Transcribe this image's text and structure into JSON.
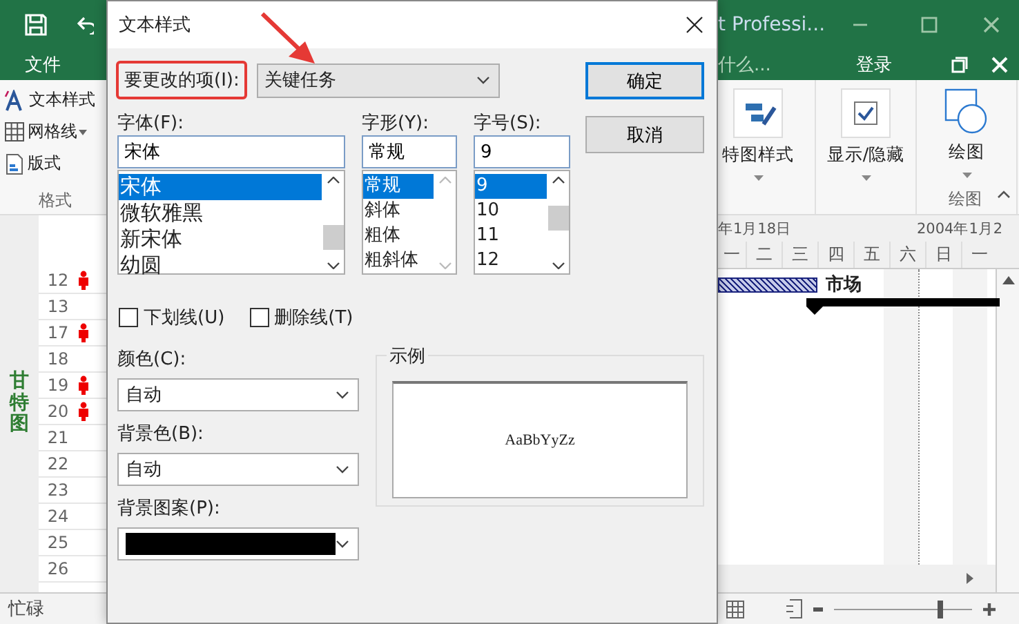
{
  "app": {
    "title": "t Professi...",
    "menu_tab": "文件",
    "tell_me": "什么...",
    "sign_in": "登录",
    "ribbon_left": [
      {
        "kind": "icon_a",
        "label": "文本样式",
        "dropdown": false
      },
      {
        "kind": "icon_grid",
        "label": "网格线",
        "dropdown": true
      },
      {
        "kind": "icon_layout",
        "label": "版式",
        "dropdown": false
      }
    ],
    "ribbon_left_group": "格式",
    "ribbon_right": [
      {
        "kind": "icon_bar_style",
        "label": "特图样式"
      },
      {
        "kind": "icon_check",
        "label": "显示/隐藏"
      },
      {
        "kind": "icon_shape",
        "label": "绘图"
      }
    ],
    "ribbon_right_group": "绘图",
    "view_label": "甘特图",
    "rows": [
      {
        "number": "12",
        "person": true
      },
      {
        "number": "13",
        "person": false
      },
      {
        "number": "17",
        "person": true
      },
      {
        "number": "18",
        "person": false
      },
      {
        "number": "19",
        "person": true
      },
      {
        "number": "20",
        "person": true
      },
      {
        "number": "21",
        "person": false
      },
      {
        "number": "22",
        "person": false
      },
      {
        "number": "23",
        "person": false
      },
      {
        "number": "24",
        "person": false
      },
      {
        "number": "25",
        "person": false
      },
      {
        "number": "26",
        "person": false
      }
    ],
    "timeline": {
      "weeks": [
        "年1月18日",
        "2004年1月2"
      ],
      "days": [
        "一",
        "二",
        "三",
        "四",
        "五",
        "六",
        "日",
        "一"
      ],
      "task_label": "市场"
    },
    "status": "忙碌",
    "zoom": {
      "level": 0.77
    }
  },
  "dialog": {
    "title": "文本样式",
    "item_label": "要更改的项(I):",
    "item_value": "关键任务",
    "font": {
      "label": "字体(F):",
      "value": "宋体",
      "options": [
        {
          "text": "宋体",
          "selected": true
        },
        {
          "text": "微软雅黑",
          "selected": false
        },
        {
          "text": "新宋体",
          "selected": false
        },
        {
          "text": "幼圆",
          "selected": false
        }
      ]
    },
    "style": {
      "label": "字形(Y):",
      "value": "常规",
      "options": [
        {
          "text": "常规",
          "selected": true
        },
        {
          "text": "斜体",
          "selected": false
        },
        {
          "text": "粗体",
          "selected": false
        },
        {
          "text": "粗斜体",
          "selected": false
        }
      ]
    },
    "size": {
      "label": "字号(S):",
      "value": "9",
      "options": [
        {
          "text": "9",
          "selected": true
        },
        {
          "text": "10",
          "selected": false
        },
        {
          "text": "11",
          "selected": false
        },
        {
          "text": "12",
          "selected": false
        }
      ]
    },
    "checkboxes": [
      {
        "label": "下划线(U)",
        "checked": false
      },
      {
        "label": "删除线(T)",
        "checked": false
      }
    ],
    "color": {
      "label": "颜色(C):",
      "value": "自动"
    },
    "background_color": {
      "label": "背景色(B):",
      "value": "自动"
    },
    "background_pattern": {
      "label": "背景图案(P):"
    },
    "sample": {
      "label": "示例",
      "text": "AaBbYyZz"
    },
    "buttons": [
      {
        "label": "确定",
        "default": true
      },
      {
        "label": "取消",
        "default": false
      }
    ]
  }
}
